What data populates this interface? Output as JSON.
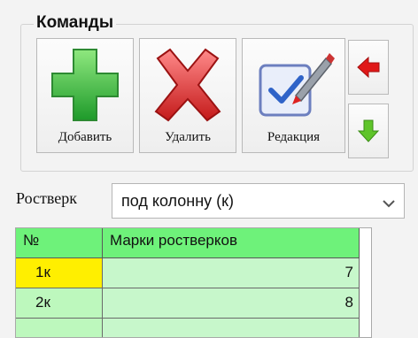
{
  "commands": {
    "title": "Команды",
    "add_label": "Добавить",
    "delete_label": "Удалить",
    "edit_label": "Редакция",
    "up_icon": "red-left-arrow-icon",
    "down_icon": "green-down-arrow-icon"
  },
  "rostverk": {
    "label": "Ростверк",
    "selected": "под колонну (к)"
  },
  "grid": {
    "headers": [
      "№",
      "Марки ростверков"
    ],
    "rows": [
      {
        "id": "1к",
        "value": "7"
      },
      {
        "id": "2к",
        "value": "8"
      }
    ]
  },
  "colors": {
    "header_bg": "#6ef27a",
    "cell_bg": "#c7f7cb",
    "selected_row_bg": "#ffef00"
  }
}
